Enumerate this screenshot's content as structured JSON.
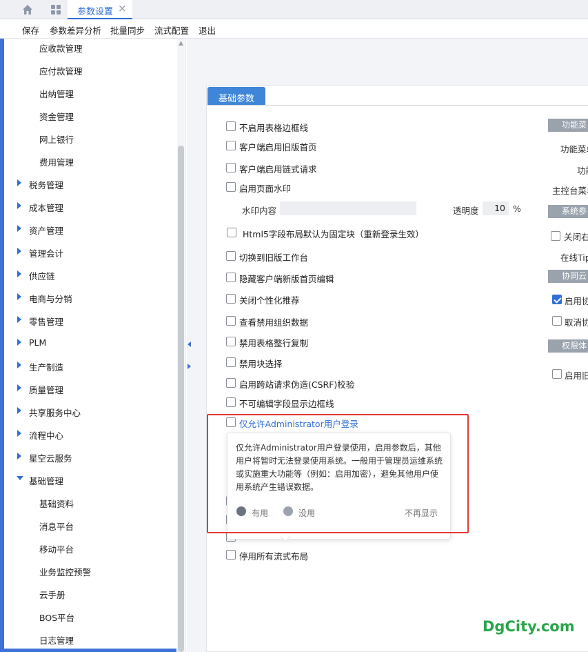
{
  "tabs": {
    "active_label": "参数设置",
    "close_glyph": "×"
  },
  "toolbar": {
    "items": [
      "保存",
      "参数差异分析",
      "批量同步",
      "流式配置",
      "退出"
    ]
  },
  "sidebar": {
    "sub_items_top": [
      "应收款管理",
      "应付款管理",
      "出纳管理",
      "资金管理",
      "网上银行",
      "费用管理"
    ],
    "top_items": [
      "税务管理",
      "成本管理",
      "资产管理",
      "管理会计",
      "供应链",
      "电商与分销",
      "零售管理",
      "PLM",
      "生产制造",
      "质量管理",
      "共享服务中心",
      "流程中心",
      "星空云服务"
    ],
    "expanded_item": "基础管理",
    "sub_items_bottom": [
      "基础资料",
      "消息平台",
      "移动平台",
      "业务监控预警",
      "云手册",
      "BOS平台",
      "日志管理"
    ]
  },
  "panel": {
    "tab_label": "基础参数",
    "options": [
      "不启用表格边框线",
      "客户端启用旧版首页",
      "客户端启用链式请求",
      "启用页面水印",
      "Html5字段布局默认为固定块（重新登录生效）",
      "切换到旧版工作台",
      "隐藏客户端新版首页编辑",
      "关闭个性化推荐",
      "查看禁用组织数据",
      "禁用表格整行复制",
      "禁用块选择",
      "启用跨站请求伪造(CSRF)校验",
      "不可编辑字段显示边框线",
      "仅允许Administrator用户登录",
      "停用所有流式布局"
    ],
    "watermark_label": "水印内容",
    "watermark_value": "",
    "opacity_label": "透明度",
    "opacity_value": "10",
    "opacity_unit": "%"
  },
  "right_column": {
    "group1": "功能菜",
    "r1": "功能菜单",
    "r2": "功能",
    "r3": "主控台菜单",
    "group2": "系统参",
    "r4": "关闭右",
    "r5": "在线Tip",
    "group3": "协同云",
    "r6": "启用协",
    "r7": "取消协",
    "group4": "权限体",
    "r8": "启用旧"
  },
  "tooltip": {
    "text": "仅允许Administrator用户登录使用，启用参数后，其他用户将暂时无法登录使用系统。一般用于管理员运维系统或实施重大功能等（例如：启用加密），避免其他用户使用系统产生错误数据。",
    "useful": "有用",
    "useless": "没用",
    "dont_show": "不再显示"
  },
  "watermark_text": "DgCity.com",
  "colors": {
    "accent": "#2f6fd6",
    "highlight": "#e53935",
    "watermark": "#2aa54a"
  }
}
